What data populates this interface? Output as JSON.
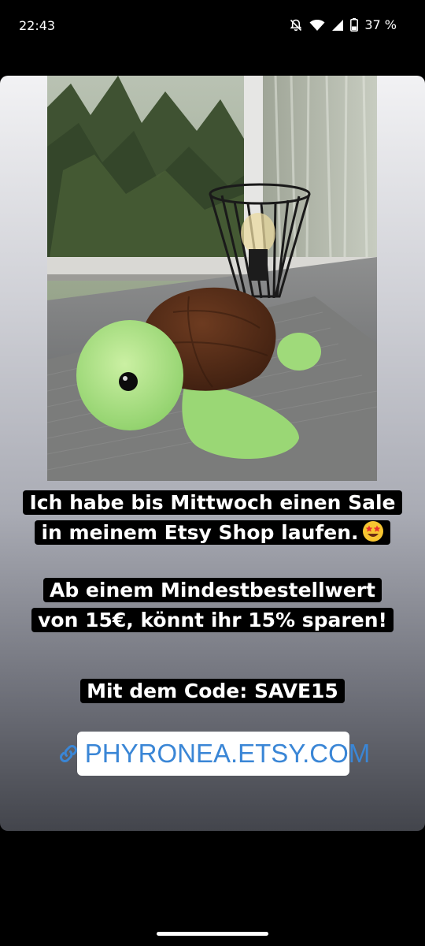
{
  "status_bar": {
    "time": "22:43",
    "battery_percent": "37 %",
    "icons": [
      "notifications-off-icon",
      "wifi-icon",
      "signal-icon",
      "battery-icon"
    ]
  },
  "story": {
    "captions": {
      "line1a": "Ich habe bis Mittwoch einen Sale",
      "line1b": "in meinem Etsy Shop laufen.",
      "emoji": "star-struck-emoji",
      "line2a": "Ab einem Mindestbestellwert",
      "line2b": "von 15€, könnt ihr 15% sparen!",
      "line3": "Mit dem Code: SAVE15"
    },
    "link_sticker": {
      "icon": "link-icon",
      "label": "PHYRONEA.ETSY.COM"
    }
  },
  "colors": {
    "link": "#3a86d6",
    "caption_bg": "#000000",
    "caption_text": "#ffffff"
  }
}
